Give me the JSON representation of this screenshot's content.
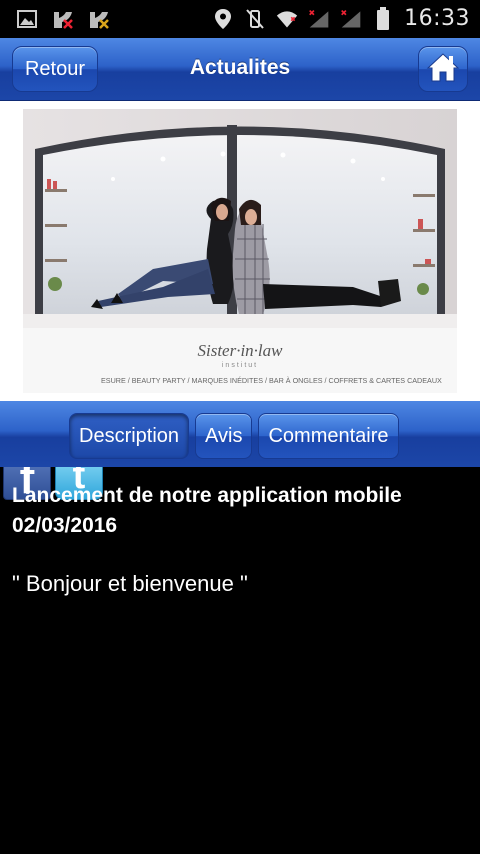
{
  "status_bar": {
    "time": "16:33",
    "icons": [
      "image-icon",
      "missed-call-icon",
      "missed-call-icon",
      "location-icon",
      "vibrate-off-icon",
      "wifi-icon",
      "signal-icon",
      "signal-icon",
      "battery-icon"
    ]
  },
  "header": {
    "back_label": "Retour",
    "title": "Actualites",
    "home_icon": "home-icon"
  },
  "photo": {
    "logo_text": "Sister·in·law",
    "logo_sub": "institut",
    "caption_strip": "ESURE / BEAUTY PARTY / MARQUES INÉDITES / BAR À ONGLES / COFFRETS & CARTES CADEAUX"
  },
  "social": {
    "facebook_glyph": "f",
    "twitter_glyph": "t"
  },
  "tabs": [
    {
      "label": "Description",
      "active": true
    },
    {
      "label": "Avis",
      "active": false
    },
    {
      "label": "Commentaire",
      "active": false
    }
  ],
  "article": {
    "headline": "Lancement de notre application mobile 02/03/2016",
    "body": "\" Bonjour et bienvenue \""
  },
  "colors": {
    "header_blue": "#2d62c9",
    "background": "#000000"
  }
}
